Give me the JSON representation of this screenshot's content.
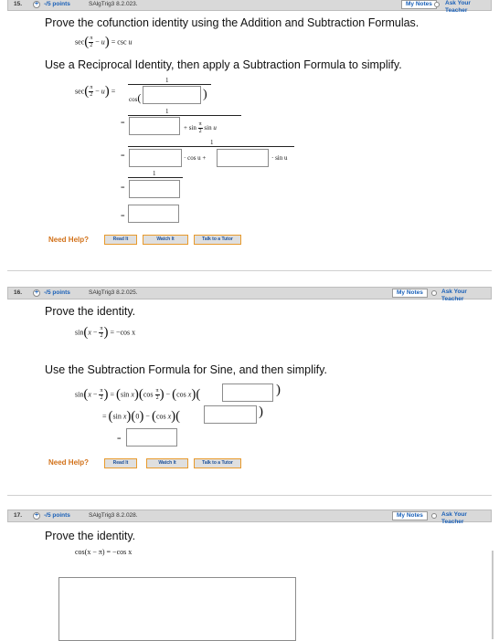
{
  "header_links": {
    "notes": "My Notes",
    "ask": "Ask Your Teacher"
  },
  "q15": {
    "number": "15.",
    "points": "-/5 points",
    "source": "SAlgTrig3 8.2.023.",
    "prompt": "Prove the cofunction identity using the Addition and Subtraction Formulas.",
    "instruction": "Use a Reciprocal Identity, then apply a Subtraction Formula to simplify.",
    "one": "1",
    "pi": "π",
    "two": "2",
    "sec": "sec",
    "cos": "cos",
    "u": "u",
    "csc": "csc",
    "eq": "=",
    "sin": "sin",
    "plus_sin": "+ sin",
    "cos_u_plus": "· cos u +",
    "sin_u_tail": "· sin u",
    "minus": "−",
    "answer_boxes": [
      "",
      "",
      "",
      "",
      "",
      ""
    ]
  },
  "q16": {
    "number": "16.",
    "points": "-/5 points",
    "source": "SAlgTrig3 8.2.025.",
    "prompt": "Prove the identity.",
    "instruction": "Use the Subtraction Formula for Sine, and then simplify.",
    "sin": "sin",
    "cos": "cos",
    "x": "x",
    "pi": "π",
    "two": "2",
    "rhs": "= −cos x",
    "zero": "0",
    "answer_boxes": [
      "",
      "",
      ""
    ]
  },
  "q17": {
    "number": "17.",
    "points": "-/5 points",
    "source": "SAlgTrig3 8.2.028.",
    "prompt": "Prove the identity.",
    "identity": "cos(x − π) = −cos x",
    "answer": ""
  },
  "help": {
    "label": "Need Help?",
    "read": "Read It",
    "watch": "Watch It",
    "tutor": "Talk to a Tutor"
  }
}
